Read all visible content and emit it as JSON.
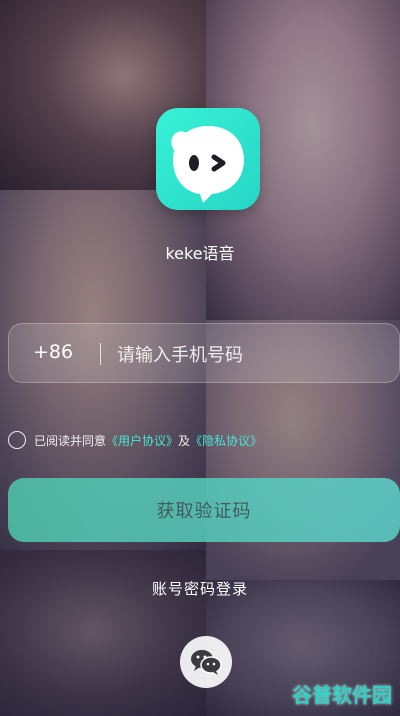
{
  "app": {
    "name": "keke语音"
  },
  "login": {
    "country_code": "+86",
    "phone_placeholder": "请输入手机号码",
    "agreement": {
      "prefix": "已阅读并同意",
      "user_agreement": "《用户协议》",
      "conjunction": "及",
      "privacy_policy": "《隐私协议》"
    },
    "get_code_label": "获取验证码",
    "password_login_label": "账号密码登录"
  },
  "watermark": {
    "text": "谷普软件园"
  },
  "colors": {
    "accent": "#45e8d2",
    "logo": "#2fe6cf",
    "button": "#5cc7b8"
  },
  "icons": {
    "logo": "ghost-face-icon",
    "social": "wechat-icon",
    "checkbox": "radio-circle-icon"
  }
}
